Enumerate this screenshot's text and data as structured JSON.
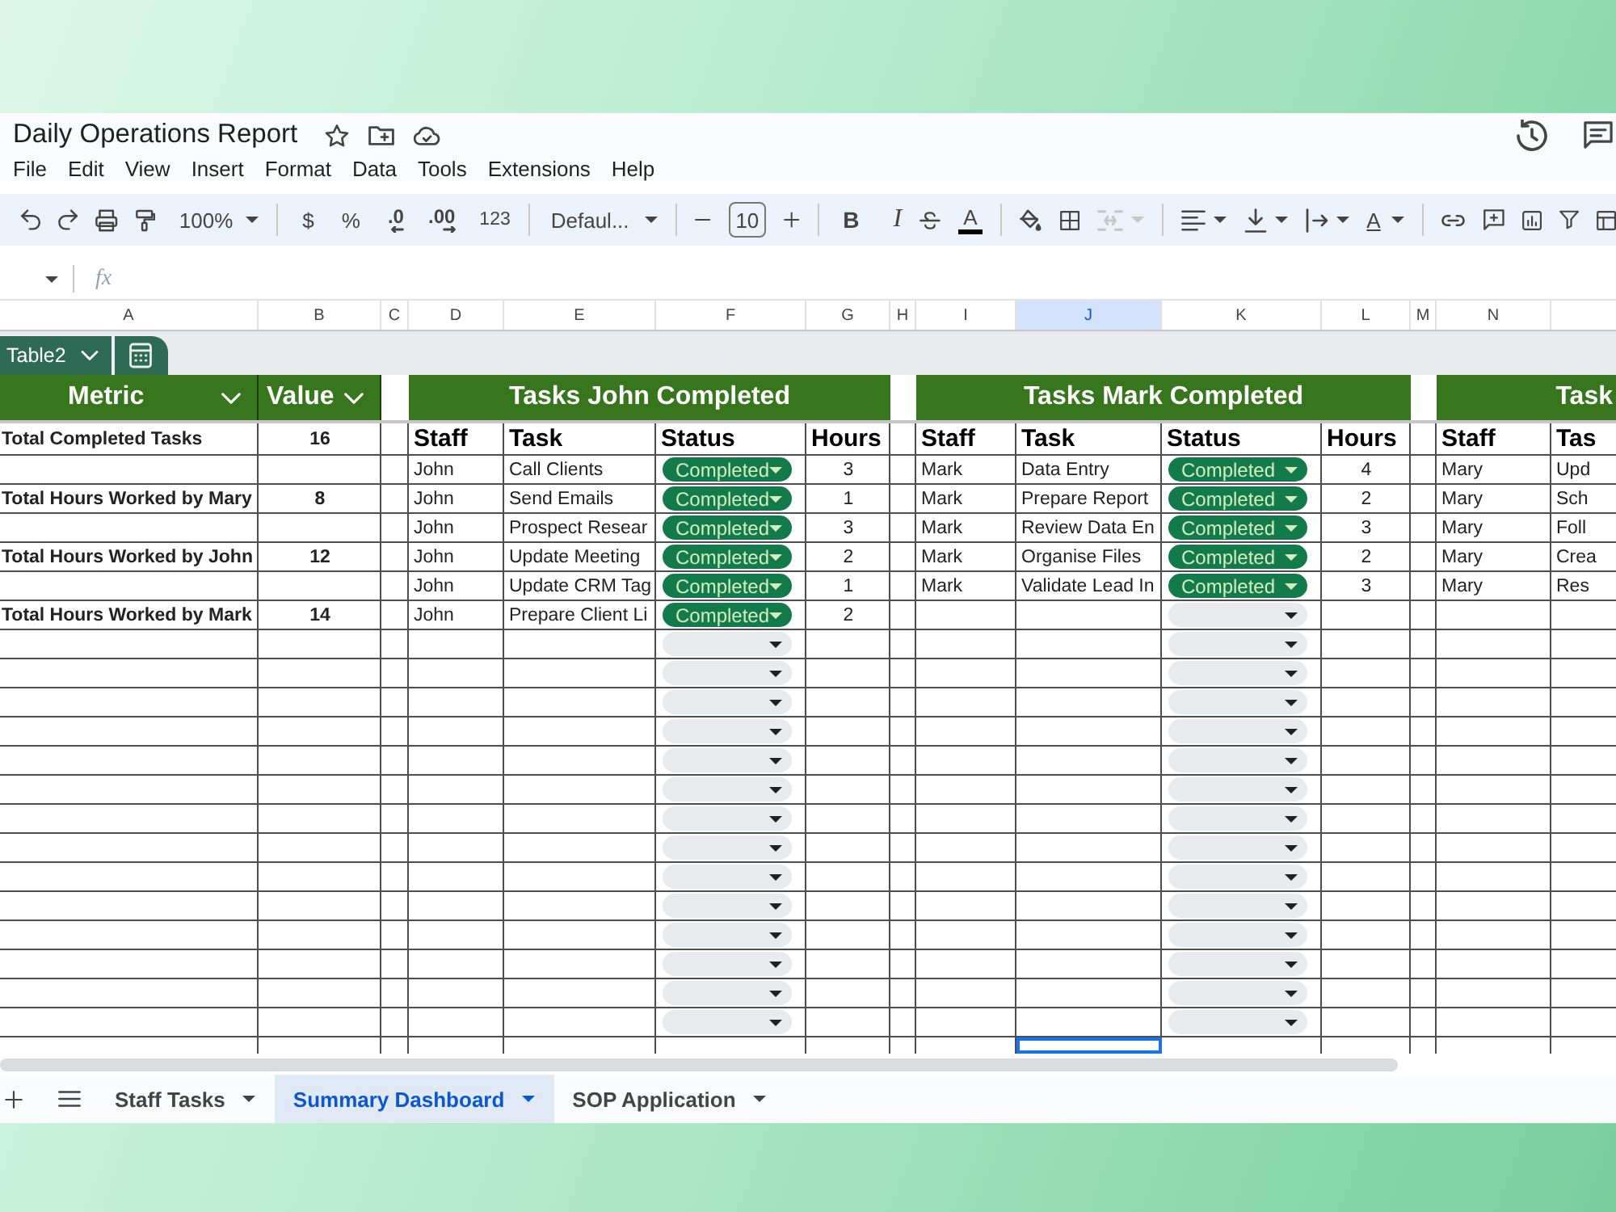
{
  "window": {
    "title": "Daily Operations Report"
  },
  "menu": [
    "File",
    "Edit",
    "View",
    "Insert",
    "Format",
    "Data",
    "Tools",
    "Extensions",
    "Help"
  ],
  "toolbar": {
    "zoom": "100%",
    "currency": "$",
    "percent": "%",
    "decrease_decimal": ".0",
    "increase_decimal": ".00",
    "number_format": "123",
    "font": "Defaul...",
    "font_size": "10",
    "bold": "B",
    "italic": "I",
    "text_color": "A",
    "merge_disabled": true,
    "text_rotation": "A"
  },
  "formula_bar": {
    "label": "fx"
  },
  "columns": [
    {
      "label": "A",
      "selected": false
    },
    {
      "label": "B",
      "selected": false
    },
    {
      "label": "C",
      "selected": false
    },
    {
      "label": "D",
      "selected": false
    },
    {
      "label": "E",
      "selected": false
    },
    {
      "label": "F",
      "selected": false
    },
    {
      "label": "G",
      "selected": false
    },
    {
      "label": "H",
      "selected": false
    },
    {
      "label": "I",
      "selected": false
    },
    {
      "label": "J",
      "selected": true
    },
    {
      "label": "K",
      "selected": false
    },
    {
      "label": "L",
      "selected": false
    },
    {
      "label": "M",
      "selected": false
    },
    {
      "label": "N",
      "selected": false
    }
  ],
  "table_tab": {
    "name": "Table2"
  },
  "metrics": {
    "columns": [
      "Metric",
      "Value"
    ],
    "rows": [
      {
        "metric": "Total Completed Tasks",
        "value": "16"
      },
      {
        "metric": "Total Hours Worked by Mary",
        "value": "8"
      },
      {
        "metric": "Total Hours Worked by John",
        "value": "12"
      },
      {
        "metric": "Total Hours Worked by Mark",
        "value": "14"
      }
    ]
  },
  "sections": [
    {
      "title": "Tasks John Completed",
      "columns": [
        "Staff",
        "Task",
        "Status",
        "Hours"
      ],
      "rows": [
        {
          "kind": "entry",
          "staff": "John",
          "task": "Call Clients",
          "status": "Completed",
          "hours": "3"
        },
        {
          "kind": "entry",
          "staff": "John",
          "task": "Send Emails",
          "status": "Completed",
          "hours": "1"
        },
        {
          "kind": "entry",
          "staff": "John",
          "task": "Prospect Resear",
          "status": "Completed",
          "hours": "3"
        },
        {
          "kind": "entry",
          "staff": "John",
          "task": "Update Meeting",
          "status": "Completed",
          "hours": "2"
        },
        {
          "kind": "entry",
          "staff": "John",
          "task": "Update CRM Tag",
          "status": "Completed",
          "hours": "1"
        },
        {
          "kind": "entry",
          "staff": "John",
          "task": "Prepare Client Li",
          "status": "Completed",
          "hours": "2"
        },
        {
          "kind": "blank"
        },
        {
          "kind": "blank"
        },
        {
          "kind": "blank"
        },
        {
          "kind": "blank"
        },
        {
          "kind": "blank"
        },
        {
          "kind": "blank"
        },
        {
          "kind": "blank"
        },
        {
          "kind": "blank"
        },
        {
          "kind": "blank"
        },
        {
          "kind": "blank"
        },
        {
          "kind": "blank"
        },
        {
          "kind": "blank"
        },
        {
          "kind": "blank"
        },
        {
          "kind": "blank"
        }
      ]
    },
    {
      "title": "Tasks Mark Completed",
      "columns": [
        "Staff",
        "Task",
        "Status",
        "Hours"
      ],
      "rows": [
        {
          "kind": "entry",
          "staff": "Mark",
          "task": "Data Entry",
          "status": "Completed",
          "hours": "4"
        },
        {
          "kind": "entry",
          "staff": "Mark",
          "task": "Prepare Report",
          "status": "Completed",
          "hours": "2"
        },
        {
          "kind": "entry",
          "staff": "Mark",
          "task": "Review Data En",
          "status": "Completed",
          "hours": "3"
        },
        {
          "kind": "entry",
          "staff": "Mark",
          "task": "Organise Files",
          "status": "Completed",
          "hours": "2"
        },
        {
          "kind": "entry",
          "staff": "Mark",
          "task": "Validate Lead In",
          "status": "Completed",
          "hours": "3"
        },
        {
          "kind": "blank"
        },
        {
          "kind": "blank"
        },
        {
          "kind": "blank"
        },
        {
          "kind": "blank"
        },
        {
          "kind": "blank"
        },
        {
          "kind": "blank"
        },
        {
          "kind": "blank"
        },
        {
          "kind": "blank"
        },
        {
          "kind": "blank"
        },
        {
          "kind": "blank"
        },
        {
          "kind": "blank"
        },
        {
          "kind": "blank"
        },
        {
          "kind": "blank"
        },
        {
          "kind": "blank"
        },
        {
          "kind": "blank"
        }
      ]
    },
    {
      "title": "Task",
      "columns": [
        "Staff",
        "Tas"
      ],
      "rows": [
        {
          "kind": "entry",
          "staff": "Mary",
          "task": "Upd"
        },
        {
          "kind": "entry",
          "staff": "Mary",
          "task": "Sch"
        },
        {
          "kind": "entry",
          "staff": "Mary",
          "task": "Foll"
        },
        {
          "kind": "entry",
          "staff": "Mary",
          "task": "Crea"
        },
        {
          "kind": "entry",
          "staff": "Mary",
          "task": "Res"
        }
      ]
    }
  ],
  "sheet_tabs": [
    {
      "label": "Staff Tasks",
      "selected": false
    },
    {
      "label": "Summary Dashboard",
      "selected": true
    },
    {
      "label": "SOP Application",
      "selected": false
    }
  ]
}
